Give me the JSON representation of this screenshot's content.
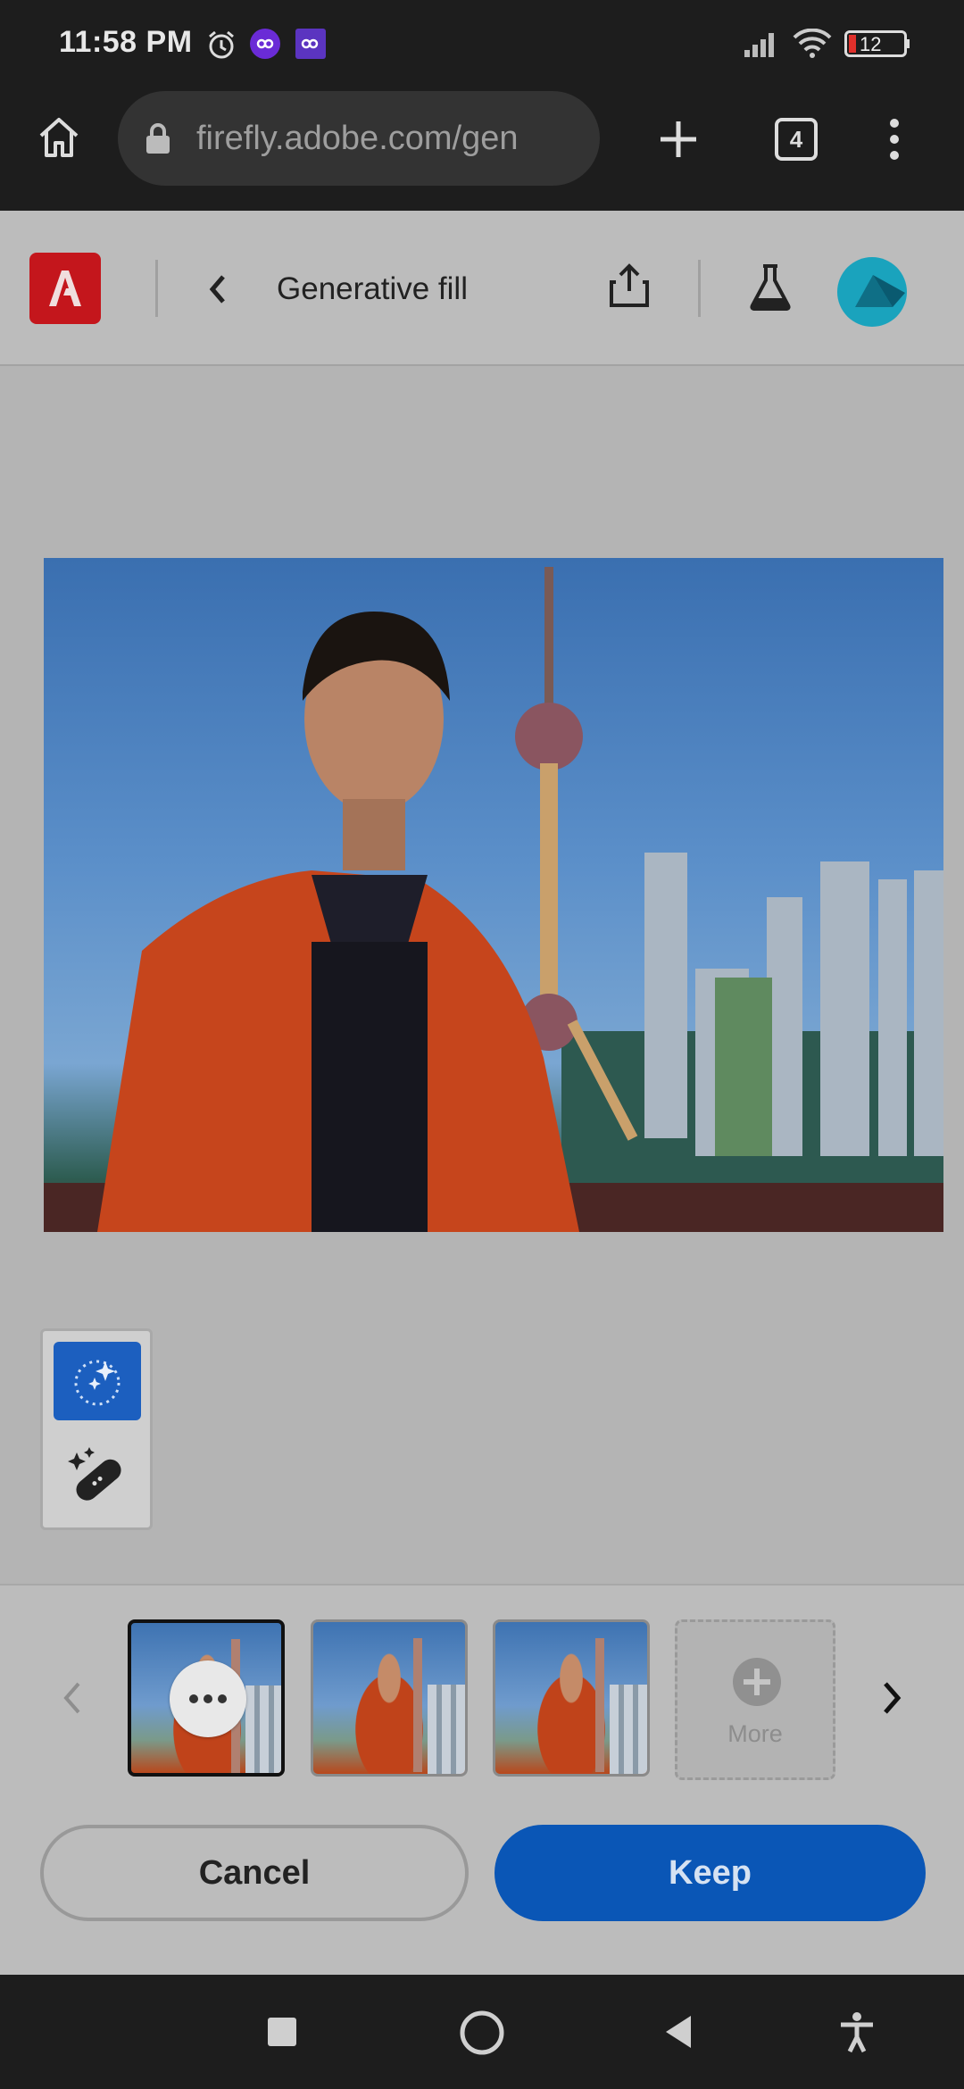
{
  "status_bar": {
    "time": "11:58 PM",
    "battery": "12",
    "icons": [
      "alarm-icon",
      "link-app-icon",
      "link-app-icon",
      "signal-icon",
      "wifi-icon",
      "battery-icon"
    ]
  },
  "browser": {
    "url": "firefly.adobe.com/gen",
    "tab_count": "4",
    "icons": [
      "home-icon",
      "lock-icon",
      "new-tab-icon",
      "tabs-icon",
      "menu-icon"
    ]
  },
  "app_header": {
    "logo_icon": "adobe-icon",
    "title": "Generative fill",
    "icons": [
      "back-icon",
      "share-icon",
      "lab-flask-icon",
      "avatar"
    ]
  },
  "tools": {
    "items": [
      "insert-sparkle-icon",
      "remove-bandage-icon"
    ],
    "selected_index": 0
  },
  "variations": {
    "selected_index": 0,
    "count": 3,
    "more_label": "More",
    "icons": [
      "chevron-left-icon",
      "more-dots-icon",
      "plus-icon",
      "chevron-right-icon"
    ]
  },
  "actions": {
    "cancel_label": "Cancel",
    "keep_label": "Keep"
  },
  "colors": {
    "keep_button": "#0a56b6",
    "adobe_red": "#c4161c",
    "tool_selected": "#1c5fbf",
    "avatar": "#1aa3bd"
  },
  "nav_bar": {
    "icons": [
      "recents-square-icon",
      "home-circle-icon",
      "back-triangle-icon",
      "accessibility-icon"
    ]
  }
}
